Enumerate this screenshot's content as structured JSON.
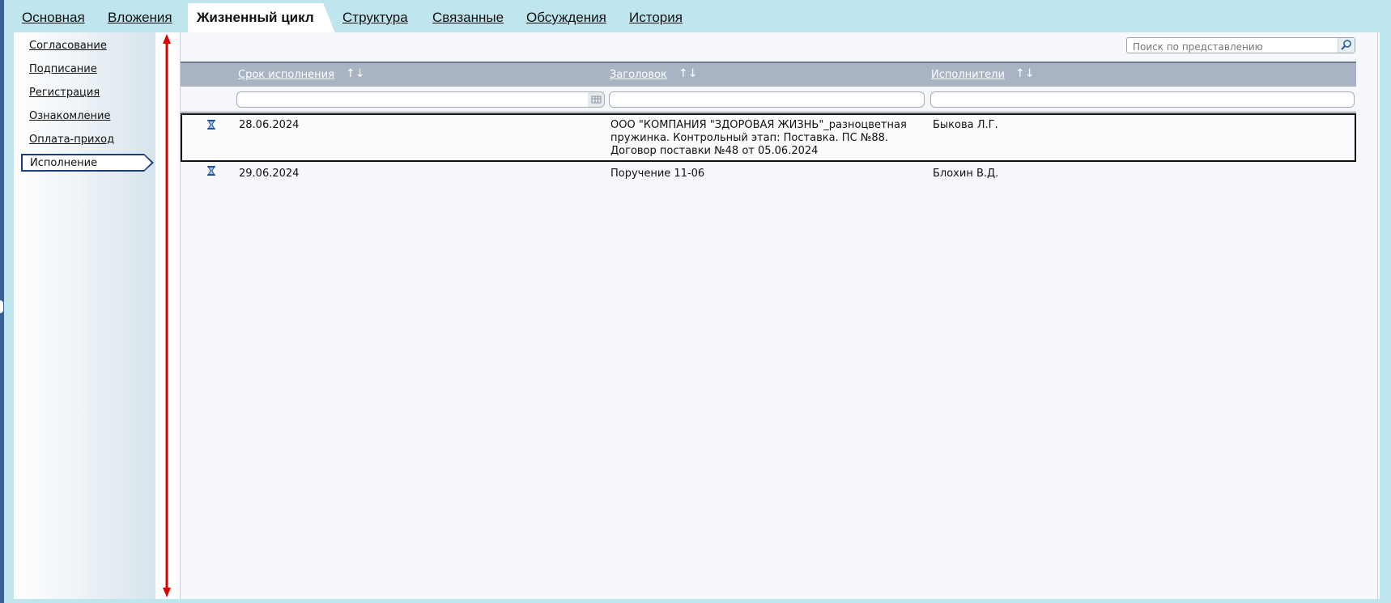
{
  "tabs": [
    {
      "label": "Основная",
      "active": false
    },
    {
      "label": "Вложения",
      "active": false
    },
    {
      "label": "Жизненный цикл",
      "active": true
    },
    {
      "label": "Структура",
      "active": false
    },
    {
      "label": "Связанные",
      "active": false
    },
    {
      "label": "Обсуждения",
      "active": false
    },
    {
      "label": "История",
      "active": false
    }
  ],
  "sidebar": {
    "items": [
      {
        "label": "Согласование",
        "active": false
      },
      {
        "label": "Подписание",
        "active": false
      },
      {
        "label": "Регистрация",
        "active": false
      },
      {
        "label": "Ознакомление",
        "active": false
      },
      {
        "label": "Оплата-приход",
        "active": false
      },
      {
        "label": "Исполнение",
        "active": true
      }
    ]
  },
  "search": {
    "placeholder": "Поиск по представлению",
    "icon": "search-icon"
  },
  "table": {
    "columns": [
      {
        "label": "Срок исполнения",
        "sort_icon": "↑↓"
      },
      {
        "label": "Заголовок",
        "sort_icon": "↑↓"
      },
      {
        "label": "Исполнители",
        "sort_icon": "↑↓"
      }
    ],
    "rows": [
      {
        "status_icon": "hourglass-icon",
        "due_date": "28.06.2024",
        "title_lines": [
          "ООО \"КОМПАНИЯ \"ЗДОРОВАЯ ЖИЗНЬ\"_разноцветная",
          "пружинка. Контрольный этап: Поставка. ПС №88.",
          "Договор поставки №48 от 05.06.2024"
        ],
        "executors": "Быкова Л.Г.",
        "selected": true
      },
      {
        "status_icon": "hourglass-icon",
        "due_date": "29.06.2024",
        "title_lines": [
          "Поручение 11-06"
        ],
        "executors": "Блохин В.Д.",
        "selected": false
      }
    ]
  },
  "colors": {
    "background": "#bfe6ef",
    "header": "#a8b4c4",
    "selection_border": "#111111",
    "arrow": "#e00000",
    "sidebar_active_border": "#1c3e7a"
  }
}
